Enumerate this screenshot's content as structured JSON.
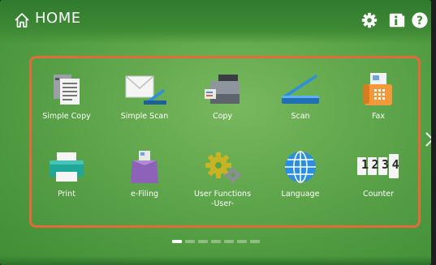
{
  "header": {
    "title": "HOME"
  },
  "apps": [
    {
      "label": "Simple Copy"
    },
    {
      "label": "Simple Scan"
    },
    {
      "label": "Copy"
    },
    {
      "label": "Scan"
    },
    {
      "label": "Fax"
    },
    {
      "label": "Print"
    },
    {
      "label": "e-Filing"
    },
    {
      "label": "User Functions\n-User-"
    },
    {
      "label": "Language"
    },
    {
      "label": "Counter"
    }
  ],
  "counter_digits": "1234",
  "pagination": {
    "pages": 7,
    "current": 1
  },
  "colors": {
    "panel_border": "#e46a3b",
    "background": "#5aa347"
  }
}
